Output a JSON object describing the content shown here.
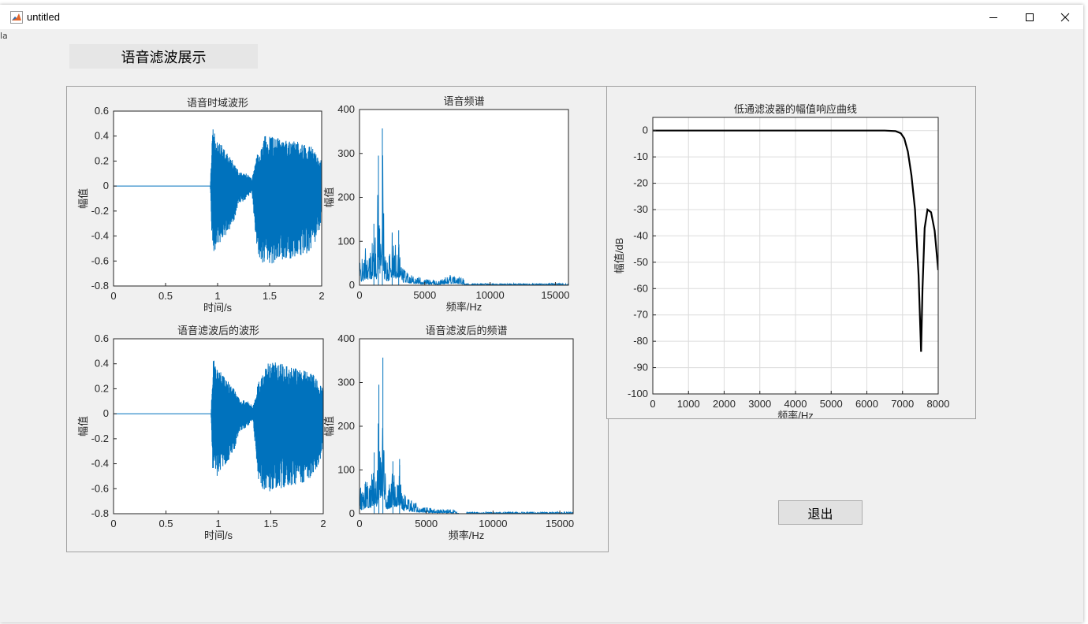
{
  "window": {
    "title": "untitled",
    "icon": "matlab-icon",
    "controls": [
      "minimize-icon",
      "maximize-icon",
      "close-icon"
    ]
  },
  "edge_text": "la",
  "header_label": "语音滤波展示",
  "exit_button": "退出",
  "colors": {
    "signal": "#0072BD",
    "filter": "#000000",
    "axes_bg": "#ffffff",
    "window_bg": "#f0f0f0"
  },
  "chart_data": [
    {
      "type": "line",
      "title": "语音时域波形",
      "xlabel": "时间/s",
      "ylabel": "幅值",
      "xlim": [
        0,
        2
      ],
      "ylim": [
        -0.8,
        0.6
      ],
      "xticks": [
        "0",
        "0.5",
        "1",
        "1.5",
        "2"
      ],
      "yticks": [
        "-0.8",
        "-0.6",
        "-0.4",
        "-0.2",
        "0",
        "0.2",
        "0.4",
        "0.6"
      ],
      "series": [
        {
          "envelope_x": [
            0,
            0.93,
            0.95,
            1.0,
            1.05,
            1.1,
            1.15,
            1.2,
            1.28,
            1.33,
            1.38,
            1.42,
            1.45,
            1.5,
            1.6,
            1.7,
            1.8,
            1.9,
            2.0
          ],
          "upper": [
            0,
            0,
            0.47,
            0.35,
            0.32,
            0.25,
            0.2,
            0.12,
            0.1,
            0.06,
            0.25,
            0.3,
            0.4,
            0.41,
            0.39,
            0.37,
            0.35,
            0.32,
            0.2
          ],
          "lower": [
            0,
            0,
            -0.55,
            -0.48,
            -0.42,
            -0.38,
            -0.3,
            -0.15,
            -0.1,
            -0.05,
            -0.55,
            -0.6,
            -0.63,
            -0.63,
            -0.6,
            -0.58,
            -0.56,
            -0.54,
            -0.3
          ]
        }
      ]
    },
    {
      "type": "line",
      "title": "语音频谱",
      "xlabel": "频率/Hz",
      "ylabel": "幅值",
      "xlim": [
        0,
        16000
      ],
      "ylim": [
        0,
        400
      ],
      "xticks": [
        "0",
        "5000",
        "10000",
        "15000"
      ],
      "yticks": [
        "0",
        "100",
        "200",
        "300",
        "400"
      ],
      "series": [
        {
          "x": [
            300,
            500,
            700,
            900,
            1100,
            1300,
            1450,
            1600,
            1750,
            1900,
            2100,
            2300,
            2500,
            2800,
            3000,
            3300,
            3600,
            4000,
            4500,
            5000,
            6000,
            7000,
            7500,
            8000
          ],
          "y": [
            60,
            100,
            80,
            90,
            140,
            90,
            295,
            120,
            357,
            100,
            60,
            75,
            120,
            100,
            125,
            45,
            40,
            30,
            20,
            15,
            10,
            25,
            20,
            15
          ]
        }
      ]
    },
    {
      "type": "line",
      "title": "语音滤波后的波形",
      "xlabel": "时间/s",
      "ylabel": "幅值",
      "xlim": [
        0,
        2
      ],
      "ylim": [
        -0.8,
        0.6
      ],
      "xticks": [
        "0",
        "0.5",
        "1",
        "1.5",
        "2"
      ],
      "yticks": [
        "-0.8",
        "-0.6",
        "-0.4",
        "-0.2",
        "0",
        "0.2",
        "0.4",
        "0.6"
      ],
      "series": [
        {
          "envelope_x": [
            0,
            0.93,
            0.95,
            1.0,
            1.05,
            1.1,
            1.15,
            1.2,
            1.28,
            1.33,
            1.38,
            1.42,
            1.45,
            1.5,
            1.6,
            1.7,
            1.8,
            1.9,
            2.0
          ],
          "upper": [
            0,
            0,
            0.48,
            0.35,
            0.32,
            0.25,
            0.2,
            0.12,
            0.1,
            0.06,
            0.25,
            0.3,
            0.4,
            0.42,
            0.4,
            0.37,
            0.35,
            0.32,
            0.2
          ],
          "lower": [
            0,
            0,
            -0.57,
            -0.48,
            -0.42,
            -0.38,
            -0.3,
            -0.15,
            -0.1,
            -0.05,
            -0.55,
            -0.6,
            -0.63,
            -0.63,
            -0.6,
            -0.58,
            -0.56,
            -0.54,
            -0.3
          ]
        }
      ]
    },
    {
      "type": "line",
      "title": "语音滤波后的频谱",
      "xlabel": "频率/Hz",
      "ylabel": "幅值",
      "xlim": [
        0,
        16000
      ],
      "ylim": [
        0,
        400
      ],
      "xticks": [
        "0",
        "5000",
        "10000",
        "15000"
      ],
      "yticks": [
        "0",
        "100",
        "200",
        "300",
        "400"
      ],
      "series": [
        {
          "x": [
            300,
            500,
            700,
            900,
            1100,
            1300,
            1450,
            1600,
            1750,
            1900,
            2100,
            2300,
            2500,
            2800,
            3000,
            3300,
            3600,
            4000,
            4500,
            5000,
            6000,
            7000,
            7500,
            8000
          ],
          "y": [
            60,
            100,
            80,
            90,
            140,
            90,
            295,
            120,
            357,
            100,
            60,
            75,
            120,
            100,
            125,
            45,
            40,
            30,
            20,
            15,
            10,
            10,
            0,
            0
          ]
        }
      ]
    },
    {
      "type": "line",
      "title": "低通滤波器的幅值响应曲线",
      "xlabel": "频率/Hz",
      "ylabel": "幅值/dB",
      "xlim": [
        0,
        8000
      ],
      "ylim": [
        -100,
        5
      ],
      "grid": true,
      "xticks": [
        "0",
        "1000",
        "2000",
        "3000",
        "4000",
        "5000",
        "6000",
        "7000",
        "8000"
      ],
      "yticks": [
        "0",
        "-10",
        "-20",
        "-30",
        "-40",
        "-50",
        "-60",
        "-70",
        "-80",
        "-90",
        "-100"
      ],
      "series": [
        {
          "x": [
            0,
            6500,
            6800,
            6950,
            7050,
            7150,
            7250,
            7350,
            7450,
            7520,
            7560,
            7620,
            7700,
            7800,
            7900,
            8000
          ],
          "y": [
            0,
            0,
            -0.2,
            -1,
            -3,
            -8,
            -17,
            -30,
            -55,
            -84,
            -60,
            -37,
            -30,
            -31,
            -38,
            -53
          ]
        }
      ]
    }
  ]
}
